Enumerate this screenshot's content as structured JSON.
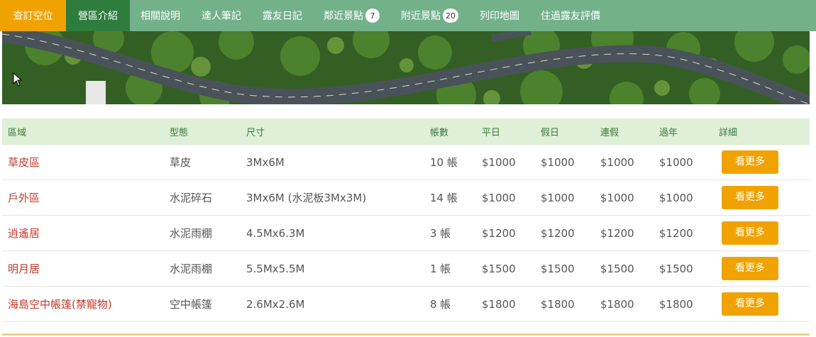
{
  "nav": {
    "items": [
      {
        "label": "查訂空位",
        "kind": "book"
      },
      {
        "label": "營區介紹",
        "kind": "active"
      },
      {
        "label": "相關說明",
        "kind": "plain"
      },
      {
        "label": "達人筆記",
        "kind": "plain"
      },
      {
        "label": "露友日記",
        "kind": "plain"
      },
      {
        "label": "鄰近景點",
        "kind": "plain",
        "badge": "7"
      },
      {
        "label": "附近景點",
        "kind": "plain",
        "badge": "20"
      },
      {
        "label": "列印地圖",
        "kind": "plain"
      },
      {
        "label": "住過露友評價",
        "kind": "plain"
      }
    ]
  },
  "banner": {
    "icon": "aerial-road-photo"
  },
  "table": {
    "headers": [
      "區域",
      "型態",
      "尺寸",
      "帳數",
      "平日",
      "假日",
      "連假",
      "過年",
      "詳細"
    ],
    "rows": [
      {
        "area": "草皮區",
        "type": "草皮",
        "size": "3Mx6M",
        "tents": "10 帳",
        "weekday": "$1000",
        "holiday": "$1000",
        "long_holiday": "$1000",
        "new_year": "$1000",
        "more": "看更多"
      },
      {
        "area": "戶外區",
        "type": "水泥碎石",
        "size": "3Mx6M (水泥板3Mx3M)",
        "tents": "14 帳",
        "weekday": "$1000",
        "holiday": "$1000",
        "long_holiday": "$1000",
        "new_year": "$1000",
        "more": "看更多"
      },
      {
        "area": "逍遙居",
        "type": "水泥雨棚",
        "size": "4.5Mx6.3M",
        "tents": "3 帳",
        "weekday": "$1200",
        "holiday": "$1200",
        "long_holiday": "$1200",
        "new_year": "$1200",
        "more": "看更多"
      },
      {
        "area": "明月居",
        "type": "水泥雨棚",
        "size": "5.5Mx5.5M",
        "tents": "1 帳",
        "weekday": "$1500",
        "holiday": "$1500",
        "long_holiday": "$1500",
        "new_year": "$1500",
        "more": "看更多"
      },
      {
        "area": "海島空中帳篷(禁寵物)",
        "type": "空中帳篷",
        "size": "2.6Mx2.6M",
        "tents": "8 帳",
        "weekday": "$1800",
        "holiday": "$1800",
        "long_holiday": "$1800",
        "new_year": "$1800",
        "more": "看更多"
      }
    ]
  },
  "colors": {
    "nav_bg": "#73b18a",
    "book_bg": "#f0a300",
    "active_bg": "#2e7d3e",
    "header_bg": "#dff0d8",
    "area_text": "#c0392b",
    "button_bg": "#f0a300"
  }
}
